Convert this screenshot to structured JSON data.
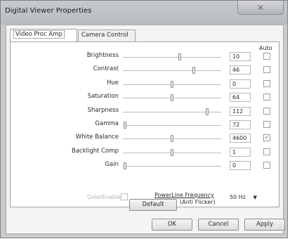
{
  "window": {
    "title": "Digital Viewer Properties",
    "close_glyph": "✕"
  },
  "tabs": [
    {
      "label": "Video Proc Amp",
      "active": true
    },
    {
      "label": "Camera Control",
      "active": false
    }
  ],
  "panel": {
    "auto_header": "Auto",
    "rows": [
      {
        "label": "Brightness",
        "value": "10",
        "level": 0.58,
        "auto": false,
        "auto_enabled": true
      },
      {
        "label": "Contrast",
        "value": "46",
        "level": 0.72,
        "auto": false,
        "auto_enabled": true
      },
      {
        "label": "Hue",
        "value": "0",
        "level": 0.5,
        "auto": false,
        "auto_enabled": true
      },
      {
        "label": "Saturation",
        "value": "64",
        "level": 0.5,
        "auto": false,
        "auto_enabled": true
      },
      {
        "label": "Sharpness",
        "value": "112",
        "level": 0.86,
        "auto": false,
        "auto_enabled": true
      },
      {
        "label": "Gamma",
        "value": "72",
        "level": 0.02,
        "auto": false,
        "auto_enabled": true
      },
      {
        "label": "White Balance",
        "value": "4600",
        "level": 0.5,
        "auto": true,
        "auto_enabled": true
      },
      {
        "label": "Backlight Comp",
        "value": "1",
        "level": 0.5,
        "auto": false,
        "auto_enabled": true
      },
      {
        "label": "Gain",
        "value": "0",
        "level": 0.02,
        "auto": false,
        "auto_enabled": true
      }
    ],
    "color_enable_label": "ColorEnable",
    "powerline_label_1": "PowerLine Frequency",
    "powerline_label_2": "(Anti Flicker)",
    "powerline_value": "50 Hz",
    "default_button": "Default"
  },
  "buttons": {
    "ok": "OK",
    "cancel": "Cancel",
    "apply": "Apply"
  }
}
